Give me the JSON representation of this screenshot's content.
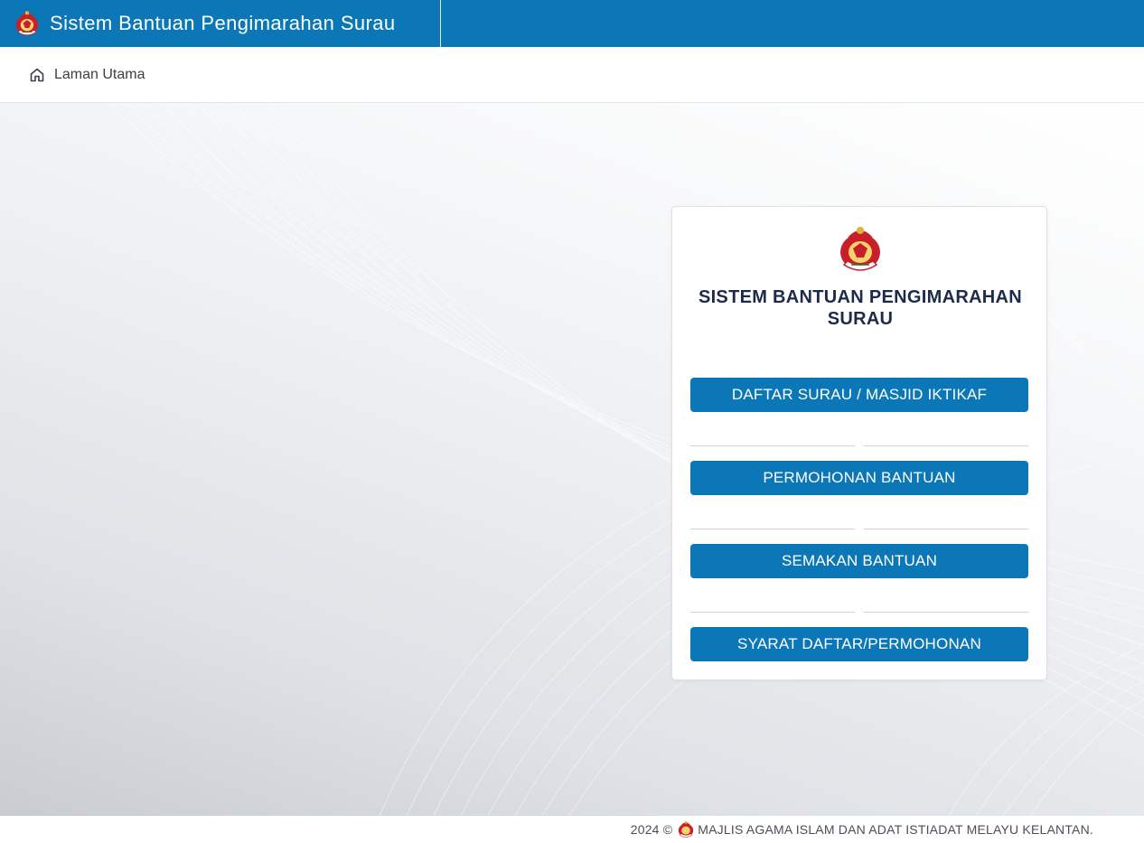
{
  "header": {
    "app_title": "Sistem Bantuan Pengimarahan Surau",
    "logo_icon": "state-crest-icon"
  },
  "subnav": {
    "home_label": "Laman Utama",
    "home_icon": "home-icon"
  },
  "card": {
    "title": "SISTEM BANTUAN PENGIMARAHAN SURAU",
    "buttons": [
      {
        "label": "DAFTAR SURAU / MASJID IKTIKAF"
      },
      {
        "label": "PERMOHONAN BANTUAN"
      },
      {
        "label": "SEMAKAN BANTUAN"
      },
      {
        "label": "SYARAT DAFTAR/PERMOHONAN"
      }
    ]
  },
  "footer": {
    "year_text": "2024 ©",
    "org_text": "MAJLIS AGAMA ISLAM DAN ADAT ISTIADAT MELAYU KELANTAN."
  },
  "colors": {
    "primary": "#0b77b6",
    "title_text": "#1d2b4a",
    "crest_red": "#c8202a",
    "crest_gold": "#e0b23a"
  }
}
